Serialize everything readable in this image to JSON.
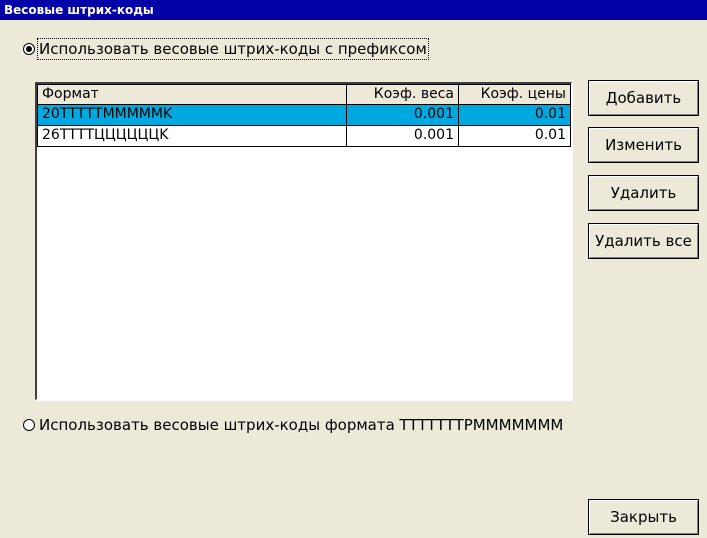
{
  "window": {
    "title": "Весовые штрих-коды"
  },
  "options": {
    "prefix": {
      "label": "Использовать весовые штрих-коды с префиксом",
      "checked": true
    },
    "format": {
      "label": "Использовать весовые штрих-коды формата ТТТТТТТРМММММММ",
      "checked": false
    }
  },
  "table": {
    "headers": [
      "Формат",
      "Коэф. веса",
      "Коэф. цены"
    ],
    "rows": [
      {
        "format": "20ТТТТТММММMK",
        "weight_coef": "0.001",
        "price_coef": "0.01",
        "selected": true
      },
      {
        "format": "26ТТТТЦЦЦЦЦЦK",
        "weight_coef": "0.001",
        "price_coef": "0.01",
        "selected": false
      }
    ]
  },
  "buttons": {
    "add": "Добавить",
    "edit": "Изменить",
    "delete": "Удалить",
    "delete_all": "Удалить все",
    "close": "Закрыть"
  },
  "colors": {
    "titlebar": "#0000a8",
    "selection": "#00a8e0",
    "background": "#ece9d8"
  }
}
